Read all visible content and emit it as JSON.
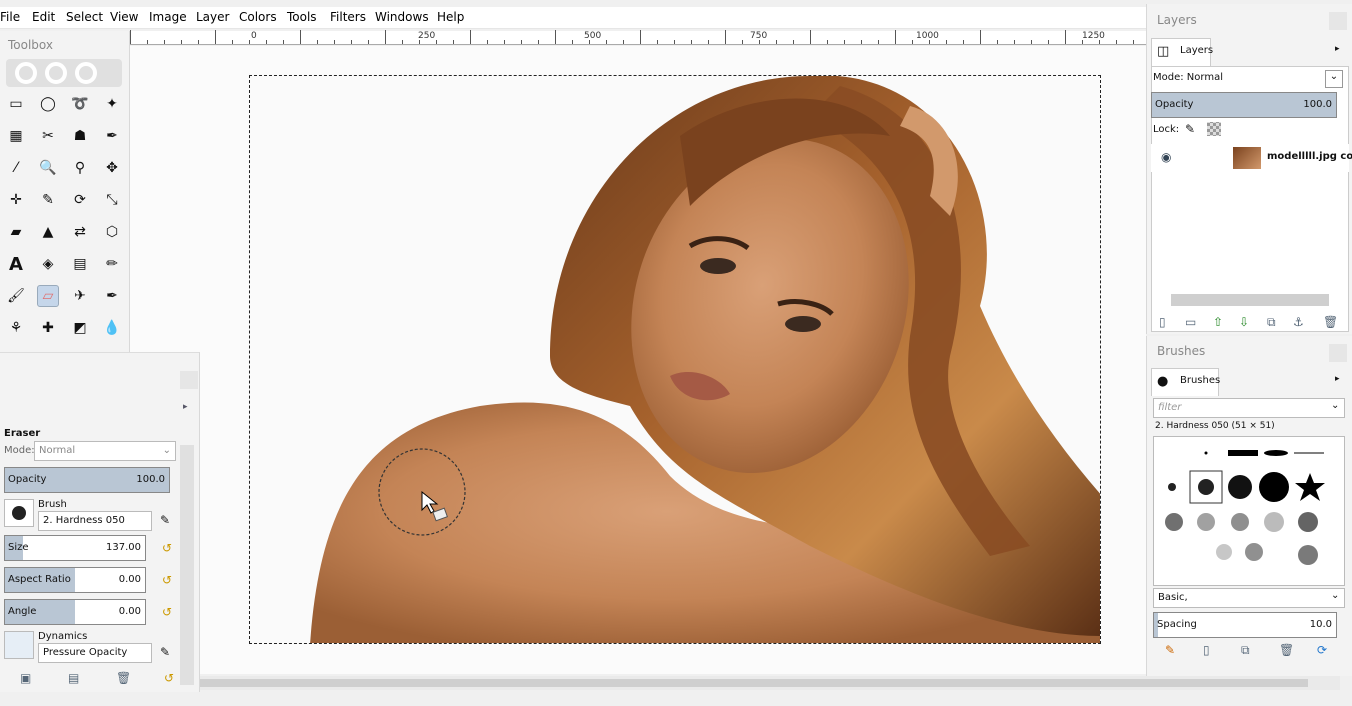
{
  "menu": [
    "File",
    "Edit",
    "Select",
    "View",
    "Image",
    "Layer",
    "Colors",
    "Tools",
    "Filters",
    "Windows",
    "Help"
  ],
  "ruler": {
    "labels": [
      "0",
      "250",
      "500",
      "750",
      "1000",
      "1250"
    ]
  },
  "toolbox": {
    "title": "Toolbox"
  },
  "tool_options": {
    "tool_name": "Eraser",
    "mode_label": "Mode:",
    "mode_value": "Normal",
    "opacity_label": "Opacity",
    "opacity_value": "100.0",
    "opacity_fraction": 1.0,
    "brush_label": "Brush",
    "brush_value": "2. Hardness 050",
    "size_label": "Size",
    "size_value": "137.00",
    "aspect_label": "Aspect Ratio",
    "aspect_value": "0.00",
    "angle_label": "Angle",
    "angle_value": "0.00",
    "dynamics_label": "Dynamics",
    "dynamics_value": "Pressure Opacity"
  },
  "layers": {
    "title": "Layers",
    "tab": "Layers",
    "mode_label": "Mode: Normal",
    "opacity_label": "Opacity",
    "opacity_value": "100.0",
    "opacity_fraction": 1.0,
    "lock_label": "Lock:",
    "layer_name": "modelllll.jpg co"
  },
  "brushes": {
    "title": "Brushes",
    "tab": "Brushes",
    "filter_placeholder": "filter",
    "current": "2. Hardness 050 (51 × 51)",
    "tag": "Basic,",
    "spacing_label": "Spacing",
    "spacing_value": "10.0"
  },
  "colors": {
    "fg": "#000000",
    "bg": "#ffffff",
    "accent": "#c5d6ea"
  }
}
